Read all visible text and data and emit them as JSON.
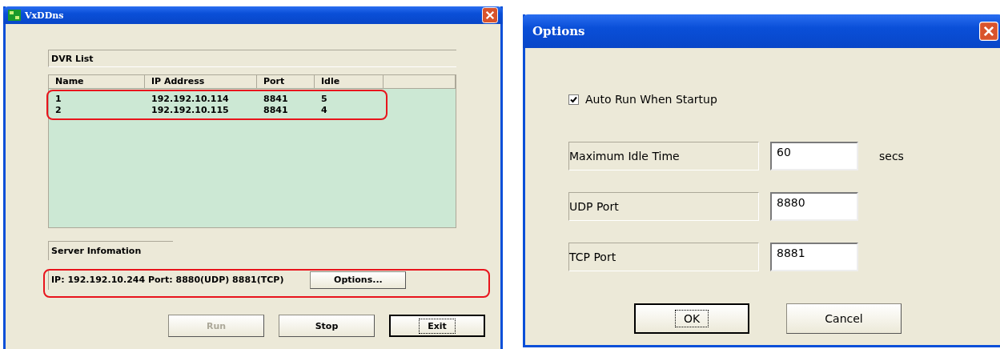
{
  "main_window": {
    "title": "VxDDns",
    "dvr_list": {
      "label": "DVR List",
      "columns": [
        "Name",
        "IP Address",
        "Port",
        "Idle"
      ],
      "rows": [
        {
          "cells": [
            "1",
            "192.192.10.114",
            "8841",
            "5"
          ]
        },
        {
          "cells": [
            "2",
            "192.192.10.115",
            "8841",
            "4"
          ]
        }
      ]
    },
    "server_info": {
      "label": "Server Infomation",
      "text": "IP: 192.192.10.244  Port: 8880(UDP) 8881(TCP)",
      "button": "Options..."
    },
    "buttons": [
      {
        "label": "Run",
        "disabled": true,
        "default": false
      },
      {
        "label": "Stop",
        "disabled": false,
        "default": false
      },
      {
        "label": "Exit",
        "disabled": false,
        "default": true
      }
    ]
  },
  "options_window": {
    "title": "Options",
    "auto_run": {
      "label": "Auto Run When Startup",
      "checked": true
    },
    "fields": [
      {
        "label": "Maximum Idle Time",
        "value": "60",
        "unit": "secs"
      },
      {
        "label": "UDP Port",
        "value": "8880"
      },
      {
        "label": "TCP Port",
        "value": "8881"
      }
    ],
    "buttons": [
      {
        "label": "OK",
        "default": true
      },
      {
        "label": "Cancel",
        "default": false
      }
    ]
  }
}
